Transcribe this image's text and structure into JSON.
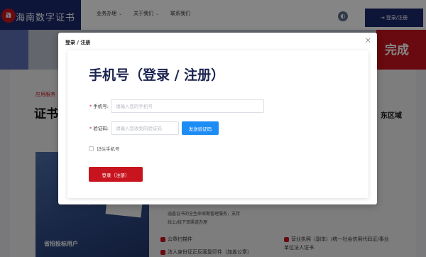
{
  "header": {
    "logo_mark": "a",
    "logo_text": "海南数字证书",
    "nav": [
      {
        "label": "业务办理"
      },
      {
        "label": "关于我们"
      },
      {
        "label": "联系我们"
      }
    ],
    "login_button": "登录/注册"
  },
  "hero": {
    "right_text": "完成"
  },
  "content": {
    "breadcrumb": "应用服务",
    "title_partial": "证书",
    "region_heading": "东区域",
    "promo_caption": "省招投标用户",
    "desc_line1": "涵盖证书的全生命周期管理服务，支持",
    "desc_line2": "线上/线下双渠道办理",
    "features": [
      "公章扫描件",
      "法人身份证正反面复印件（加盖公章）",
      "营业执照（副本）/统一社会信用代码证/事业",
      "单位法人证书"
    ]
  },
  "modal": {
    "title": "登录 / 注册",
    "close_symbol": "×",
    "heading": "手机号（登录 / 注册）",
    "phone": {
      "label": "手机号:",
      "placeholder": "请输入您的手机号",
      "value": ""
    },
    "code": {
      "label": "验证码:",
      "placeholder": "请输入您收到的验证码",
      "value": ""
    },
    "send_code_button": "发送验证码",
    "remember_label": "记住手机号",
    "submit_button": "登录（注册）"
  },
  "colors": {
    "brand_red": "#c8141e",
    "brand_navy": "#1a2a6e",
    "primary_blue": "#1e8cf5"
  }
}
